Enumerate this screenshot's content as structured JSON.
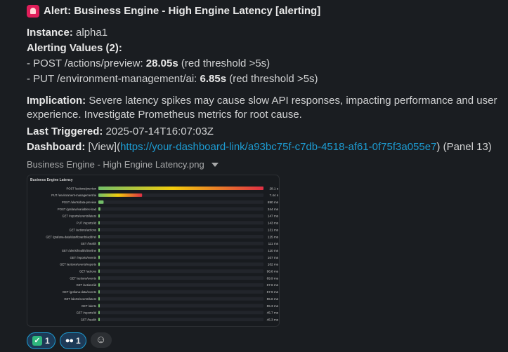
{
  "alert": {
    "title": "Alert: Business Engine - High Engine Latency [alerting]",
    "instance_label": "Instance:",
    "instance_value": " alpha1",
    "alerting_values_label": "Alerting Values (2):",
    "values": [
      {
        "prefix": "- POST /actions/preview: ",
        "value": "28.05s",
        "suffix": " (red threshold >5s)"
      },
      {
        "prefix": "- PUT /environment-management/ai: ",
        "value": "6.85s",
        "suffix": " (red threshold >5s)"
      }
    ],
    "implication_label": "Implication:",
    "implication_text": " Severe latency spikes may cause slow API responses, impacting performance and user experience. Investigate Prometheus metrics for root cause.",
    "last_triggered_label": "Last Triggered:",
    "last_triggered_value": " 2025-07-14T16:07:03Z",
    "dashboard_label": "Dashboard:",
    "dashboard_view": " [View](",
    "dashboard_link": "https://your-dashboard-link/a93bc75f-c7db-4518-af61-0f75f3a055e7",
    "dashboard_suffix": ") (Panel 13)"
  },
  "attachment": {
    "filename": "Business Engine - High Engine Latency.png"
  },
  "chart_data": {
    "type": "bar",
    "orientation": "horizontal",
    "title": "Business Engine Latency",
    "categories": [
      "POST /actions/preview",
      "PUT /environment-management/ai",
      "POST /alerts/data-preview",
      "POST /grafana/variables-load",
      "GET /reports/events/latest",
      "PUT /reports/id",
      "GET /actions/actions",
      "GET /grafana-data/dashboards/add/rel",
      "GET /health",
      "GET /alerts/health/timeline",
      "GET /reports/events",
      "GET /actions/events/reports",
      "GET /actions",
      "GET /actions/events",
      "GET /actions/id",
      "GET /grafana-data/events",
      "GET /alerts/events/latest",
      "GET /alerts",
      "GET /reports/id",
      "GET /health"
    ],
    "value_labels": [
      "28.1 s",
      "7.44 s",
      "890 ms",
      "344 ms",
      "147 ms",
      "143 ms",
      "131 ms",
      "125 ms",
      "111 ms",
      "110 ms",
      "107 ms",
      "102 ms",
      "98.8 ms",
      "89.9 ms",
      "67.6 ms",
      "57.9 ms",
      "55.6 ms",
      "55.3 ms",
      "45.7 ms",
      "45.3 ms"
    ],
    "values_ms": [
      28100,
      7440,
      890,
      344,
      147,
      143,
      131,
      125,
      111,
      110,
      107,
      102,
      98.8,
      89.9,
      67.6,
      57.9,
      55.6,
      55.3,
      45.7,
      45.3
    ],
    "xlim": [
      0,
      28100
    ],
    "colors": {
      "high": "#e02f44",
      "mid": "#f2cc0c",
      "low": "#73bf69",
      "track": "#22252b"
    }
  },
  "reactions": [
    {
      "emoji": "check-icon",
      "count": "1"
    },
    {
      "emoji": "eyes-icon",
      "count": "1"
    }
  ]
}
